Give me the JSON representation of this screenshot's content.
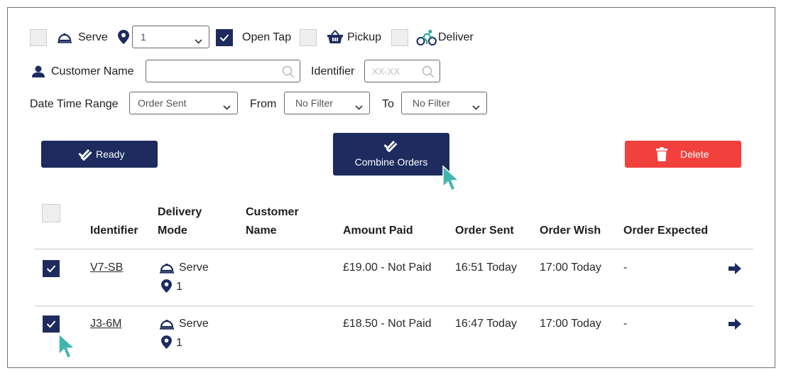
{
  "filters": {
    "serve_label": "Serve",
    "table_select_value": "1",
    "open_tap_label": "Open Tap",
    "pickup_label": "Pickup",
    "deliver_label": "Deliver",
    "customer_name_label": "Customer Name",
    "customer_name_value": "",
    "identifier_label": "Identifier",
    "identifier_placeholder": "XX-XX",
    "date_time_range_label": "Date Time Range",
    "date_time_range_value": "Order Sent",
    "from_label": "From",
    "from_value": "No Filter",
    "to_label": "To",
    "to_value": "No Filter"
  },
  "actions": {
    "ready_label": "Ready",
    "combine_label": "Combine Orders",
    "delete_label": "Delete"
  },
  "table": {
    "headers": {
      "identifier": "Identifier",
      "delivery_line1": "Delivery",
      "delivery_line2": "Mode",
      "customer_line1": "Customer",
      "customer_line2": "Name",
      "amount_paid": "Amount Paid",
      "order_sent": "Order Sent",
      "order_wish": "Order Wish",
      "order_expected": "Order Expected"
    },
    "rows": [
      {
        "identifier": "V7-SB",
        "mode": "Serve",
        "table": "1",
        "customer": "",
        "amount_paid": "£19.00 - Not Paid",
        "order_sent": "16:51 Today",
        "order_wish": "17:00 Today",
        "order_expected": "-"
      },
      {
        "identifier": "J3-6M",
        "mode": "Serve",
        "table": "1",
        "customer": "",
        "amount_paid": "£18.50 - Not Paid",
        "order_sent": "16:47 Today",
        "order_wish": "17:00 Today",
        "order_expected": "-"
      }
    ]
  },
  "colors": {
    "navy": "#1d2b5e",
    "red": "#f2403d",
    "teal_cursor": "#3fb6ad",
    "deliver_icon": "#2aa8a0"
  }
}
